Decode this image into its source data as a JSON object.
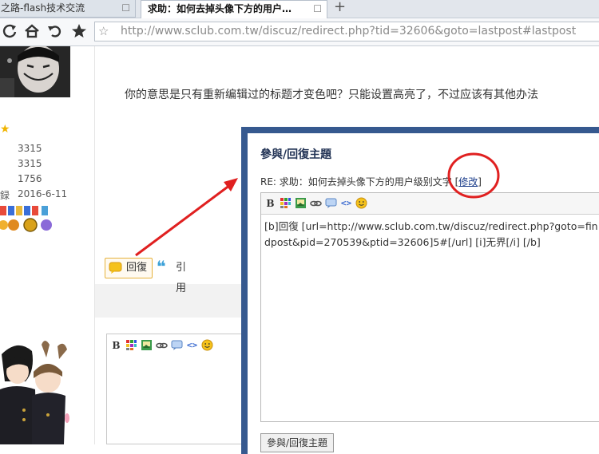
{
  "browser": {
    "tabs": [
      {
        "label": "之路-flash技术交流",
        "active": false
      },
      {
        "label": "求助：如何去掉头像下方的用户…",
        "active": true
      }
    ],
    "tab_close": "☐",
    "new_tab": "+",
    "address_url": "http://www.sclub.com.tw/discuz/redirect.php?tid=32606&goto=lastpost#lastpost"
  },
  "profile": {
    "stats": [
      {
        "label": "",
        "value": "3315"
      },
      {
        "label": "",
        "value": "3315"
      },
      {
        "label": "",
        "value": "1756"
      },
      {
        "label": "録",
        "value": "2016-6-11"
      }
    ]
  },
  "post": {
    "message": "你的意思是只有重新编辑过的标题才变色吧？只能设置高亮了，不过应该有其他办法",
    "reply_label": "回復",
    "quote_label": "引用"
  },
  "dialog": {
    "title": "參與/回復主題",
    "subject_prefix": "RE: 求助：如何去掉头像下方的用户级别文字 [",
    "edit_link": "修改",
    "subject_suffix": "]",
    "editor_text": "[b]回復 [url=http://www.sclub.com.tw/discuz/redirect.php?goto=findpost&pid=270539&ptid=32606]5#[/url] [i]无界[/i] [/b]",
    "submit_label": "參與/回復主題"
  },
  "editor_toolbar": {
    "bold": "B"
  },
  "colors": {
    "dialog_border": "#36598f",
    "annotation_red": "#e02020",
    "reply_button_border": "#e6b23c"
  }
}
